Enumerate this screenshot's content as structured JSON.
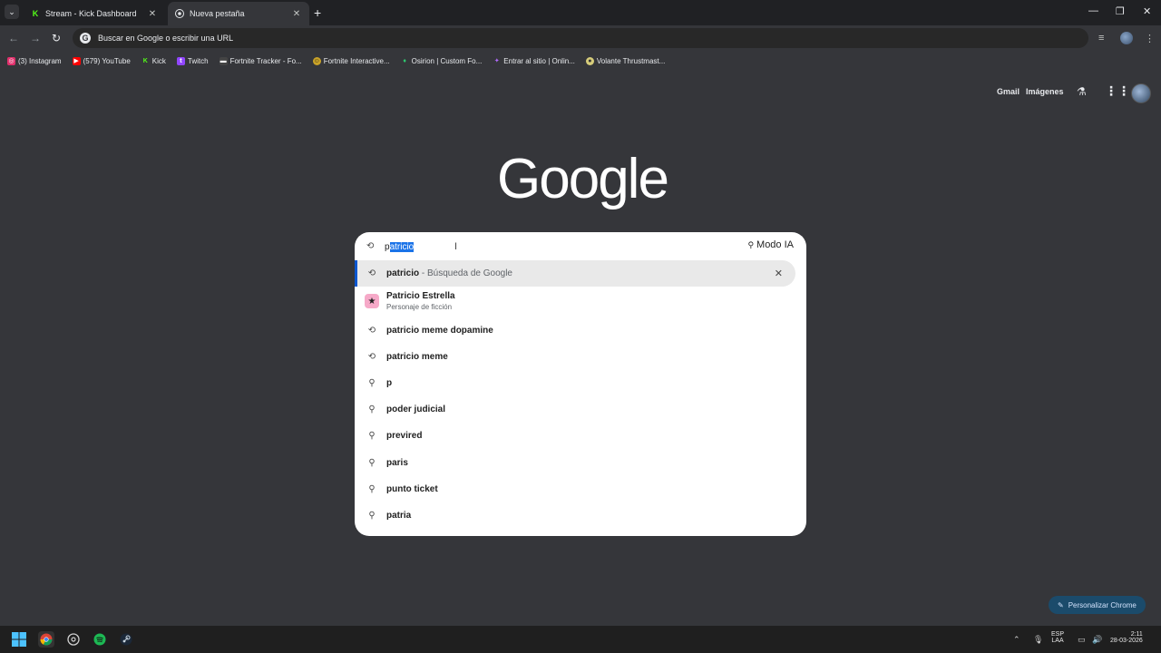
{
  "tabs": [
    {
      "title": "Stream - Kick Dashboard",
      "favicon": "kick-icon",
      "color": "#53fc18"
    },
    {
      "title": "Nueva pestaña",
      "favicon": "chrome-icon"
    }
  ],
  "omnibox": {
    "placeholder": "Buscar en Google o escribir una URL"
  },
  "bookmarks": [
    {
      "label": "(3) Instagram",
      "icon": "instagram-icon",
      "color": "#e1306c"
    },
    {
      "label": "(579) YouTube",
      "icon": "youtube-icon",
      "color": "#ff0000"
    },
    {
      "label": "Kick",
      "icon": "kick-icon",
      "color": "#53fc18"
    },
    {
      "label": "Twitch",
      "icon": "twitch-icon",
      "color": "#9146ff"
    },
    {
      "label": "Fortnite Tracker - Fo...",
      "icon": "fortnite-tracker-icon",
      "color": "#444444"
    },
    {
      "label": "Fortnite Interactive...",
      "icon": "fortnite-icon",
      "color": "#c9a227"
    },
    {
      "label": "Osirion | Custom Fo...",
      "icon": "osirion-icon",
      "color": "#2ecc71"
    },
    {
      "label": "Entrar al sitio | Onlin...",
      "icon": "online-icon",
      "color": "#b36bff"
    },
    {
      "label": "Volante Thrustmast...",
      "icon": "thrustmaster-icon",
      "color": "#d6cc7a"
    }
  ],
  "header": {
    "gmail": "Gmail",
    "images": "Imágenes"
  },
  "logo": "Google",
  "search": {
    "typed_prefix": "p",
    "selected_suffix": "atricio",
    "modo_ia": "Modo IA"
  },
  "suggestions": [
    {
      "text": "patricio",
      "sub": " - Búsqueda de Google",
      "icon": "history-icon",
      "highlighted": true
    },
    {
      "text": "Patricio Estrella",
      "sub": "Personaje de ficción",
      "icon": "patrick-star-thumbnail",
      "rich": true
    },
    {
      "text": "patricio meme dopamine",
      "icon": "history-icon"
    },
    {
      "text": "patricio meme",
      "icon": "history-icon"
    },
    {
      "text": "p",
      "icon": "search-icon"
    },
    {
      "text": "poder judicial",
      "icon": "search-icon"
    },
    {
      "text": "previred",
      "icon": "search-icon"
    },
    {
      "text": "paris",
      "icon": "search-icon"
    },
    {
      "text": "punto ticket",
      "icon": "search-icon"
    },
    {
      "text": "patria",
      "icon": "search-icon"
    }
  ],
  "personalize": "Personalizar Chrome",
  "taskbar": {
    "lang": "ESP",
    "layout": "LAA",
    "time": "2:11",
    "date": "28-03-2026"
  }
}
